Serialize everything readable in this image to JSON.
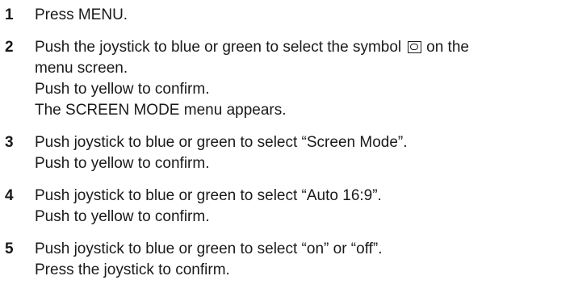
{
  "steps": [
    {
      "number": "1",
      "lines": [
        "Press MENU."
      ]
    },
    {
      "number": "2",
      "line1_before_icon": "Push the joystick to blue or green to select the symbol",
      "icon": "screen-symbol-icon",
      "line1_after_icon": "on the",
      "lines": [
        "menu screen.",
        "Push to yellow to confirm.",
        "The SCREEN MODE menu appears."
      ]
    },
    {
      "number": "3",
      "lines": [
        "Push joystick to blue or green to select “Screen Mode”.",
        "Push to yellow to confirm."
      ]
    },
    {
      "number": "4",
      "lines": [
        "Push joystick to blue or green to select “Auto 16:9”.",
        "Push to yellow to confirm."
      ]
    },
    {
      "number": "5",
      "lines": [
        "Push joystick to blue or green to select “on” or “off”.",
        "Press the joystick to confirm."
      ]
    }
  ]
}
